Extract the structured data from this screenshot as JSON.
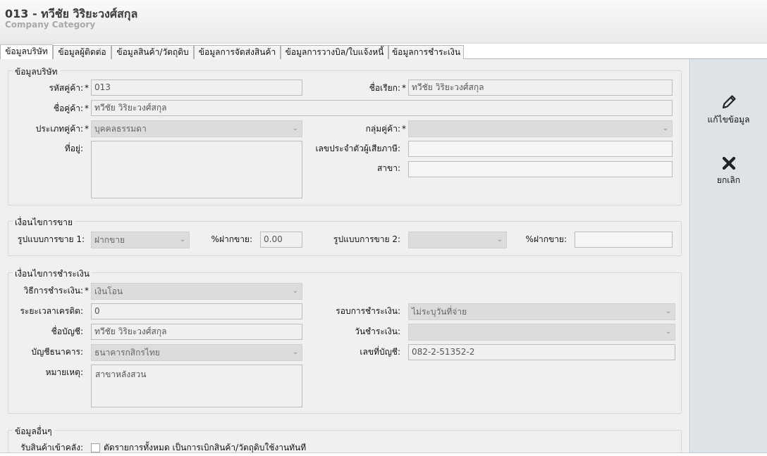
{
  "header": {
    "title": "013 - ทวีชัย วิริยะวงศ์สกุล",
    "subtitle": "Company Category"
  },
  "tabs": [
    "ข้อมูลบริษัท",
    "ข้อมูลผู้ติดต่อ",
    "ข้อมูลสินค้า/วัตถุดิบ",
    "ข้อมูลการจัดส่งสินค้า",
    "ข้อมูลการวางบิล/ใบแจ้งหนี้",
    "ข้อมูลการชำระเงิน"
  ],
  "company": {
    "legend": "ข้อมูลบริษัท",
    "code_label": "รหัสคู่ค้า:",
    "code_value": "013",
    "alias_label": "ชื่อเรียก:",
    "alias_value": "ทวีชัย วิริยะวงศ์สกุล",
    "name_label": "ชื่อคู่ค้า:",
    "name_value": "ทวีชัย วิริยะวงศ์สกุล",
    "type_label": "ประเภทคู่ค้า:",
    "type_value": "บุคคลธรรมดา",
    "group_label": "กลุ่มคู่ค้า:",
    "group_value": "",
    "address_label": "ที่อยู่:",
    "address_value": "",
    "taxid_label": "เลขประจำตัวผู้เสียภาษี:",
    "taxid_value": "",
    "branch_label": "สาขา:",
    "branch_value": "",
    "required_mark": "*"
  },
  "sales": {
    "legend": "เงื่อนไขการขาย",
    "mode1_label": "รูปแบบการขาย 1:",
    "mode1_value": "ฝากขาย",
    "pct1_label": "%ฝากขาย:",
    "pct1_value": "0.00",
    "mode2_label": "รูปแบบการขาย 2:",
    "mode2_value": "",
    "pct2_label": "%ฝากขาย:",
    "pct2_value": ""
  },
  "payment": {
    "legend": "เงื่อนไขการชำระเงิน",
    "method_label": "วิธีการชำระเงิน:",
    "method_value": "เงินโอน",
    "credit_label": "ระยะเวลาเครดิต:",
    "credit_value": "0",
    "cycle_label": "รอบการชำระเงิน:",
    "cycle_value": "ไม่ระบุวันที่จ่าย",
    "account_name_label": "ชื่อบัญชี:",
    "account_name_value": "ทวีชัย วิริยะวงศ์สกุล",
    "pay_day_label": "วันชำระเงิน:",
    "pay_day_value": "",
    "bank_label": "บัญชีธนาคาร:",
    "bank_value": "ธนาคารกสิกรไทย",
    "account_no_label": "เลขที่บัญชี:",
    "account_no_value": "082-2-51352-2",
    "note_label": "หมายเหตุ:",
    "note_value": "สาขาหลังสวน"
  },
  "other": {
    "legend": "ข้อมูลอื่นๆ",
    "receive_label": "รับสินค้าเข้าคลัง:",
    "receive_checked": false,
    "receive_text": "ตัดรายการทั้งหมด เป็นการเบิกสินค้า/วัตถุดิบใช้งานทันที"
  },
  "sidebar": {
    "edit_label": "แก้ไขข้อมูล",
    "edit_icon": "pencil-icon",
    "cancel_label": "ยกเลิก",
    "cancel_icon": "close-icon"
  }
}
